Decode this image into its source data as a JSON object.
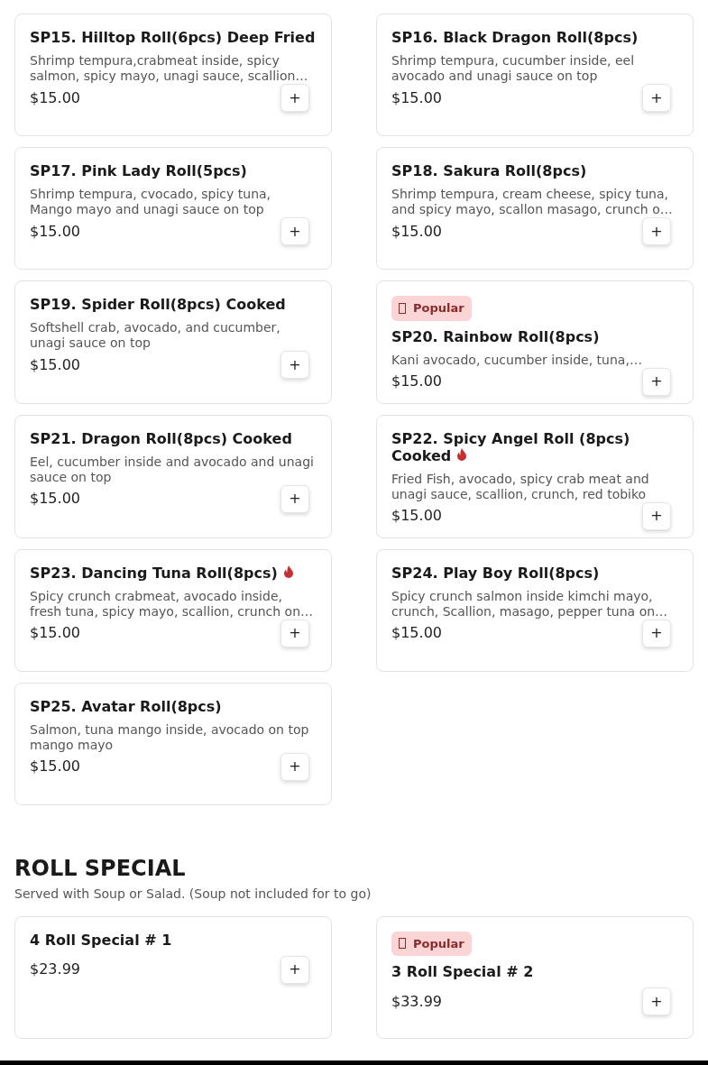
{
  "sections": [
    {
      "items": [
        {
          "name": "SP15. Hilltop Roll(6pcs) Deep Fried",
          "description": "Shrimp tempura,crabmeat inside, spicy salmon, spicy mayo, unagi sauce, scallion…",
          "price": "$15.00",
          "popular": false,
          "spicy": false,
          "add": "+"
        },
        {
          "name": "SP16. Black Dragon Roll(8pcs)",
          "description": "Shrimp tempura, cucumber inside, eel avocado and unagi sauce on top",
          "price": "$15.00",
          "popular": false,
          "spicy": false,
          "add": "+"
        },
        {
          "name": "SP17. Pink Lady Roll(5pcs)",
          "description": "Shrimp tempura, cvocado, spicy tuna, Mango mayo and unagi sauce on top",
          "price": "$15.00",
          "popular": false,
          "spicy": false,
          "add": "+"
        },
        {
          "name": "SP18. Sakura Roll(8pcs)",
          "description": "Shrimp tempura, cream cheese, spicy tuna, and spicy mayo, scallon masago, crunch o…",
          "price": "$15.00",
          "popular": false,
          "spicy": false,
          "add": "+"
        },
        {
          "name": "SP19. Spider Roll(8pcs) Cooked",
          "description": "Softshell crab, avocado, and cucumber, unagi sauce on top",
          "price": "$15.00",
          "popular": false,
          "spicy": false,
          "add": "+"
        },
        {
          "name": "SP20. Rainbow Roll(8pcs)",
          "description": "Kani avocado, cucumber inside, tuna,…",
          "price": "$15.00",
          "popular": true,
          "badge": "Popular",
          "spicy": false,
          "add": "+"
        },
        {
          "name": "SP21. Dragon Roll(8pcs) Cooked",
          "description": "Eel, cucumber inside and avocado and unagi sauce on top",
          "price": "$15.00",
          "popular": false,
          "spicy": false,
          "add": "+"
        },
        {
          "name": "SP22. Spicy Angel Roll (8pcs) Cooked",
          "description": "Fried Fish, avocado, spicy crab meat and unagi sauce, scallion, crunch, red tobiko",
          "price": "$15.00",
          "popular": false,
          "spicy": true,
          "add": "+"
        },
        {
          "name": "SP23. Dancing Tuna Roll(8pcs)",
          "description": "Spicy crunch crabmeat, avocado inside, fresh tuna, spicy mayo, scallion, crunch on…",
          "price": "$15.00",
          "popular": false,
          "spicy": true,
          "add": "+"
        },
        {
          "name": "SP24. Play Boy Roll(8pcs)",
          "description": "Spicy crunch salmon inside kimchi mayo, crunch, Scallion, masago, pepper tuna on…",
          "price": "$15.00",
          "popular": false,
          "spicy": false,
          "add": "+"
        },
        {
          "name": "SP25. Avatar Roll(8pcs)",
          "description": "Salmon, tuna mango inside, avocado on top mango mayo",
          "price": "$15.00",
          "popular": false,
          "spicy": false,
          "add": "+"
        }
      ]
    },
    {
      "title": "ROLL SPECIAL",
      "subtitle": "Served with Soup or Salad. (Soup not included for to go)",
      "items": [
        {
          "name": "4 Roll Special # 1",
          "price": "$23.99",
          "popular": false,
          "spicy": false,
          "add": "+"
        },
        {
          "name": "3 Roll Special # 2",
          "price": "$33.99",
          "popular": true,
          "badge": "Popular",
          "spicy": false,
          "add": "+"
        }
      ]
    }
  ]
}
